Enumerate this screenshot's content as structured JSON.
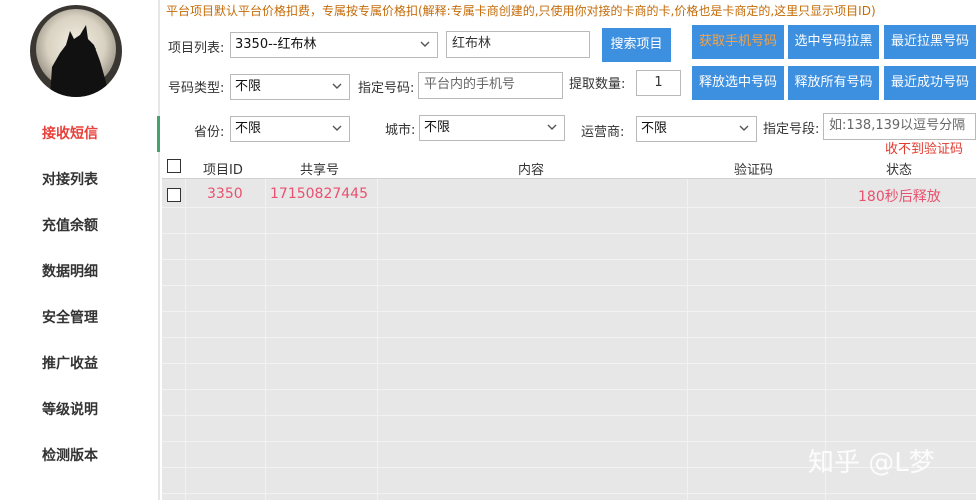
{
  "notice": "平台项目默认平台价格扣费，专属按专属价格扣(解释:专属卡商创建的,只使用你对接的卡商的卡,价格也是卡商定的,这里只显示项目ID)",
  "sidebar": {
    "items": [
      {
        "label": "接收短信",
        "active": true
      },
      {
        "label": "对接列表"
      },
      {
        "label": "充值余额"
      },
      {
        "label": "数据明细"
      },
      {
        "label": "安全管理"
      },
      {
        "label": "推广收益"
      },
      {
        "label": "等级说明"
      },
      {
        "label": "检测版本"
      }
    ]
  },
  "form": {
    "project_list_label": "项目列表:",
    "project_select_value": "3350--红布林",
    "project_search_value": "红布林",
    "search_button": "搜索项目",
    "get_phone_button": "获取手机号码",
    "blacklist_selected_button": "选中号码拉黑",
    "recent_blacklist_button": "最近拉黑号码",
    "number_type_label": "号码类型:",
    "number_type_value": "不限",
    "specify_number_label": "指定号码:",
    "specify_number_placeholder": "平台内的手机号",
    "fetch_count_label": "提取数量:",
    "fetch_count_value": "1",
    "release_selected_button": "释放选中号码",
    "release_all_button": "释放所有号码",
    "recent_success_button": "最近成功号码",
    "province_label": "省份:",
    "province_value": "不限",
    "city_label": "城市:",
    "city_value": "不限",
    "carrier_label": "运营商:",
    "carrier_value": "不限",
    "segment_label": "指定号段:",
    "segment_placeholder": "如:138,139以逗号分隔",
    "warning_text": "收不到验证码"
  },
  "table": {
    "headers": [
      "项目ID",
      "共享号",
      "内容",
      "验证码",
      "状态"
    ],
    "rows": [
      {
        "project_id": "3350",
        "shared_number": "17150827445",
        "content": "",
        "code": "",
        "status": "180秒后释放"
      }
    ]
  },
  "watermark": "知乎 @L梦",
  "colors": {
    "accent": "#3d8fe0",
    "active_nav": "#e8413c",
    "row_text": "#e8516f",
    "notice": "#c46b08"
  }
}
